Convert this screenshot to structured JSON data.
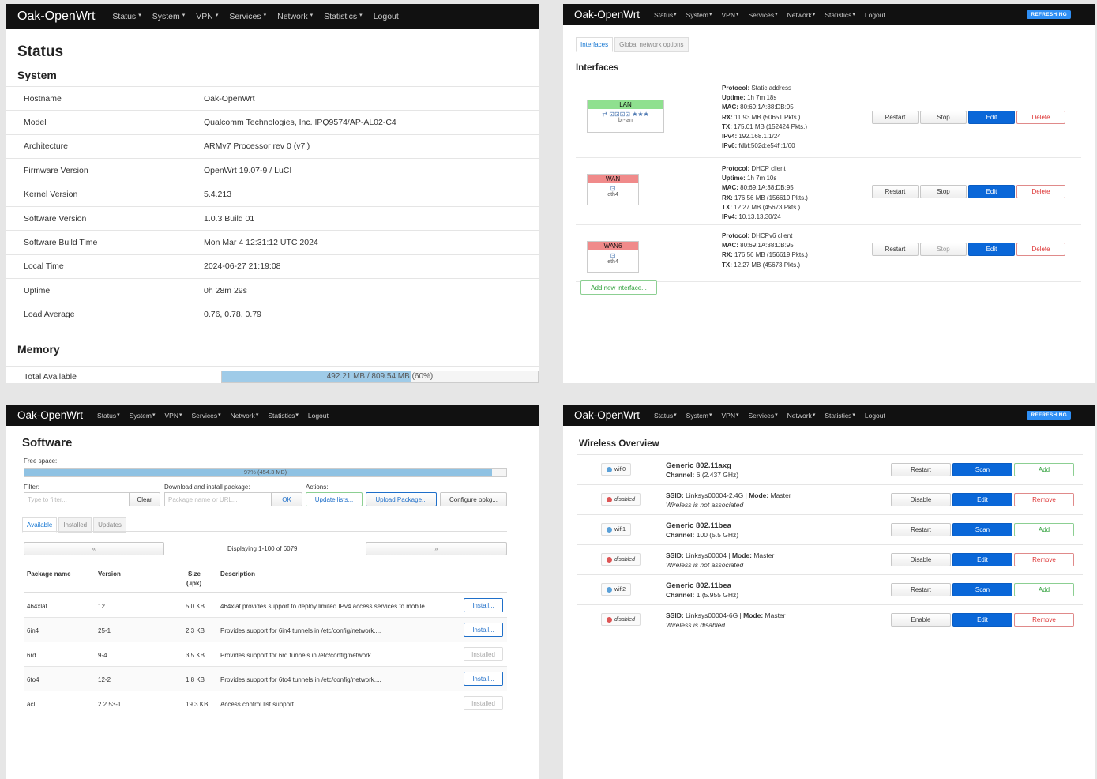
{
  "nav": {
    "brand": "Oak-OpenWrt",
    "menu": [
      "Status",
      "System",
      "VPN",
      "Services",
      "Network",
      "Statistics",
      "Logout"
    ],
    "refreshing": "REFRESHING"
  },
  "status": {
    "title": "Status",
    "system_heading": "System",
    "rows": [
      {
        "k": "Hostname",
        "v": "Oak-OpenWrt"
      },
      {
        "k": "Model",
        "v": "Qualcomm Technologies, Inc. IPQ9574/AP-AL02-C4"
      },
      {
        "k": "Architecture",
        "v": "ARMv7 Processor rev 0 (v7l)"
      },
      {
        "k": "Firmware Version",
        "v": "OpenWrt 19.07-9 / LuCI"
      },
      {
        "k": "Kernel Version",
        "v": "5.4.213"
      },
      {
        "k": "Software Version",
        "v": "1.0.3 Build 01"
      },
      {
        "k": "Software Build Time",
        "v": "Mon Mar 4 12:31:12 UTC 2024"
      },
      {
        "k": "Local Time",
        "v": "2024-06-27 21:19:08"
      },
      {
        "k": "Uptime",
        "v": "0h 28m 29s"
      },
      {
        "k": "Load Average",
        "v": "0.76, 0.78, 0.79"
      }
    ],
    "memory_heading": "Memory",
    "memory_label": "Total Available",
    "memory_text": "492.21 MB / 809.54 MB (60%)",
    "memory_fraction": 0.6
  },
  "interfaces": {
    "tabs": [
      "Interfaces",
      "Global network options"
    ],
    "heading": "Interfaces",
    "items": [
      {
        "name": "LAN",
        "color": "#8fe08f",
        "dev": "br-lan",
        "lines": [
          [
            "Protocol:",
            "Static address"
          ],
          [
            "Uptime:",
            "1h 7m 18s"
          ],
          [
            "MAC:",
            "80:69:1A:38:DB:95"
          ],
          [
            "RX:",
            "11.93 MB (50651 Pkts.)"
          ],
          [
            "TX:",
            "175.01 MB (152424 Pkts.)"
          ],
          [
            "IPv4:",
            "192.168.1.1/24"
          ],
          [
            "IPv6:",
            "fdbf:502d:e54f::1/60"
          ]
        ]
      },
      {
        "name": "WAN",
        "color": "#f08a8a",
        "dev": "eth4",
        "lines": [
          [
            "Protocol:",
            "DHCP client"
          ],
          [
            "Uptime:",
            "1h 7m 10s"
          ],
          [
            "MAC:",
            "80:69:1A:38:DB:95"
          ],
          [
            "RX:",
            "176.56 MB (156619 Pkts.)"
          ],
          [
            "TX:",
            "12.27 MB (45673 Pkts.)"
          ],
          [
            "IPv4:",
            "10.13.13.30/24"
          ]
        ]
      },
      {
        "name": "WAN6",
        "color": "#f08a8a",
        "dev": "eth4",
        "lines": [
          [
            "Protocol:",
            "DHCPv6 client"
          ],
          [
            "MAC:",
            "80:69:1A:38:DB:95"
          ],
          [
            "RX:",
            "176.56 MB (156619 Pkts.)"
          ],
          [
            "TX:",
            "12.27 MB (45673 Pkts.)"
          ]
        ]
      }
    ],
    "buttons": {
      "restart": "Restart",
      "stop": "Stop",
      "edit": "Edit",
      "delete": "Delete"
    },
    "add": "Add new interface..."
  },
  "software": {
    "title": "Software",
    "free_space_label": "Free space:",
    "free_space_text": "97% (454.3 MB)",
    "free_space_fraction": 0.97,
    "filter_label": "Filter:",
    "filter_placeholder": "Type to filter...",
    "clear": "Clear",
    "download_label": "Download and install package:",
    "download_placeholder": "Package name or URL...",
    "ok": "OK",
    "actions_label": "Actions:",
    "update_lists": "Update lists...",
    "upload": "Upload Package...",
    "configure": "Configure opkg...",
    "tabs": [
      "Available",
      "Installed",
      "Updates"
    ],
    "prev": "«",
    "next": "»",
    "displaying": "Displaying 1-100 of 6079",
    "headers": {
      "name": "Package name",
      "version": "Version",
      "size": "Size",
      "size2": "(.ipk)",
      "desc": "Description"
    },
    "rows": [
      {
        "name": "464xlat",
        "version": "12",
        "size": "5.0 KB",
        "desc": "464xlat provides support to deploy limited IPv4 access services to mobile...",
        "action": "Install...",
        "installed": false
      },
      {
        "name": "6in4",
        "version": "25-1",
        "size": "2.3 KB",
        "desc": "Provides support for 6in4 tunnels in /etc/config/network....",
        "action": "Install...",
        "installed": false
      },
      {
        "name": "6rd",
        "version": "9-4",
        "size": "3.5 KB",
        "desc": "Provides support for 6rd tunnels in /etc/config/network....",
        "action": "Installed",
        "installed": true
      },
      {
        "name": "6to4",
        "version": "12-2",
        "size": "1.8 KB",
        "desc": "Provides support for 6to4 tunnels in /etc/config/network....",
        "action": "Install...",
        "installed": false
      },
      {
        "name": "acl",
        "version": "2.2.53-1",
        "size": "19.3 KB",
        "desc": "Access control list support...",
        "action": "Installed",
        "installed": true
      }
    ]
  },
  "wireless": {
    "heading": "Wireless Overview",
    "rows": [
      {
        "dev": "wifi0",
        "kind": "radio",
        "l1b": "Generic 802.11axg",
        "l2b": "Channel:",
        "l2": " 6 (2.437 GHz)",
        "b1": "Restart",
        "b2": "Scan",
        "b3": "Add"
      },
      {
        "dev": "disabled",
        "kind": "ssid",
        "l1b": "SSID:",
        "l1": " Linksys00004-2.4G | ",
        "l1b2": "Mode:",
        "l1c": " Master",
        "l2i": "Wireless is not associated",
        "b1": "Disable",
        "b2": "Edit",
        "b3": "Remove"
      },
      {
        "dev": "wifi1",
        "kind": "radio",
        "l1b": "Generic 802.11bea",
        "l2b": "Channel:",
        "l2": " 100 (5.5 GHz)",
        "b1": "Restart",
        "b2": "Scan",
        "b3": "Add"
      },
      {
        "dev": "disabled",
        "kind": "ssid",
        "l1b": "SSID:",
        "l1": " Linksys00004 | ",
        "l1b2": "Mode:",
        "l1c": " Master",
        "l2i": "Wireless is not associated",
        "b1": "Disable",
        "b2": "Edit",
        "b3": "Remove"
      },
      {
        "dev": "wifi2",
        "kind": "radio",
        "l1b": "Generic 802.11bea",
        "l2b": "Channel:",
        "l2": " 1 (5.955 GHz)",
        "b1": "Restart",
        "b2": "Scan",
        "b3": "Add"
      },
      {
        "dev": "disabled",
        "kind": "ssid",
        "l1b": "SSID:",
        "l1": " Linksys00004-6G | ",
        "l1b2": "Mode:",
        "l1c": " Master",
        "l2i": "Wireless is disabled",
        "b1": "Enable",
        "b2": "Edit",
        "b3": "Remove"
      }
    ]
  }
}
